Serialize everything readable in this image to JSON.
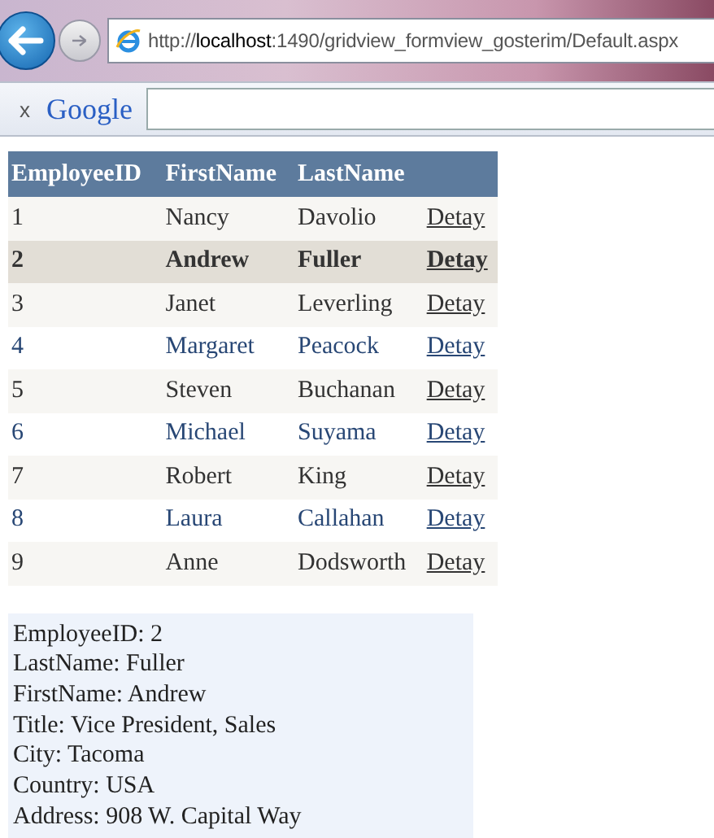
{
  "browser": {
    "address": "http://**localhost**:1490/gridview_formview_gosterim/Default.aspx",
    "google_bar": {
      "close": "x",
      "brand": "Google"
    }
  },
  "table": {
    "columns": [
      "EmployeeID",
      "FirstName",
      "LastName"
    ],
    "rows": [
      {
        "id": "1",
        "first": "Nancy",
        "last": "Davolio",
        "link": "Detay",
        "selected": false
      },
      {
        "id": "2",
        "first": "Andrew",
        "last": "Fuller",
        "link": "Detay",
        "selected": true
      },
      {
        "id": "3",
        "first": "Janet",
        "last": "Leverling",
        "link": "Detay",
        "selected": false
      },
      {
        "id": "4",
        "first": "Margaret",
        "last": "Peacock",
        "link": "Detay",
        "selected": false
      },
      {
        "id": "5",
        "first": "Steven",
        "last": "Buchanan",
        "link": "Detay",
        "selected": false
      },
      {
        "id": "6",
        "first": "Michael",
        "last": "Suyama",
        "link": "Detay",
        "selected": false
      },
      {
        "id": "7",
        "first": "Robert",
        "last": "King",
        "link": "Detay",
        "selected": false
      },
      {
        "id": "8",
        "first": "Laura",
        "last": "Callahan",
        "link": "Detay",
        "selected": false
      },
      {
        "id": "9",
        "first": "Anne",
        "last": "Dodsworth",
        "link": "Detay",
        "selected": false
      }
    ]
  },
  "details": [
    "EmployeeID: 2",
    "LastName: Fuller",
    "FirstName: Andrew",
    "Title: Vice President, Sales",
    "City: Tacoma",
    "Country: USA",
    "Address: 908 W. Capital Way"
  ]
}
